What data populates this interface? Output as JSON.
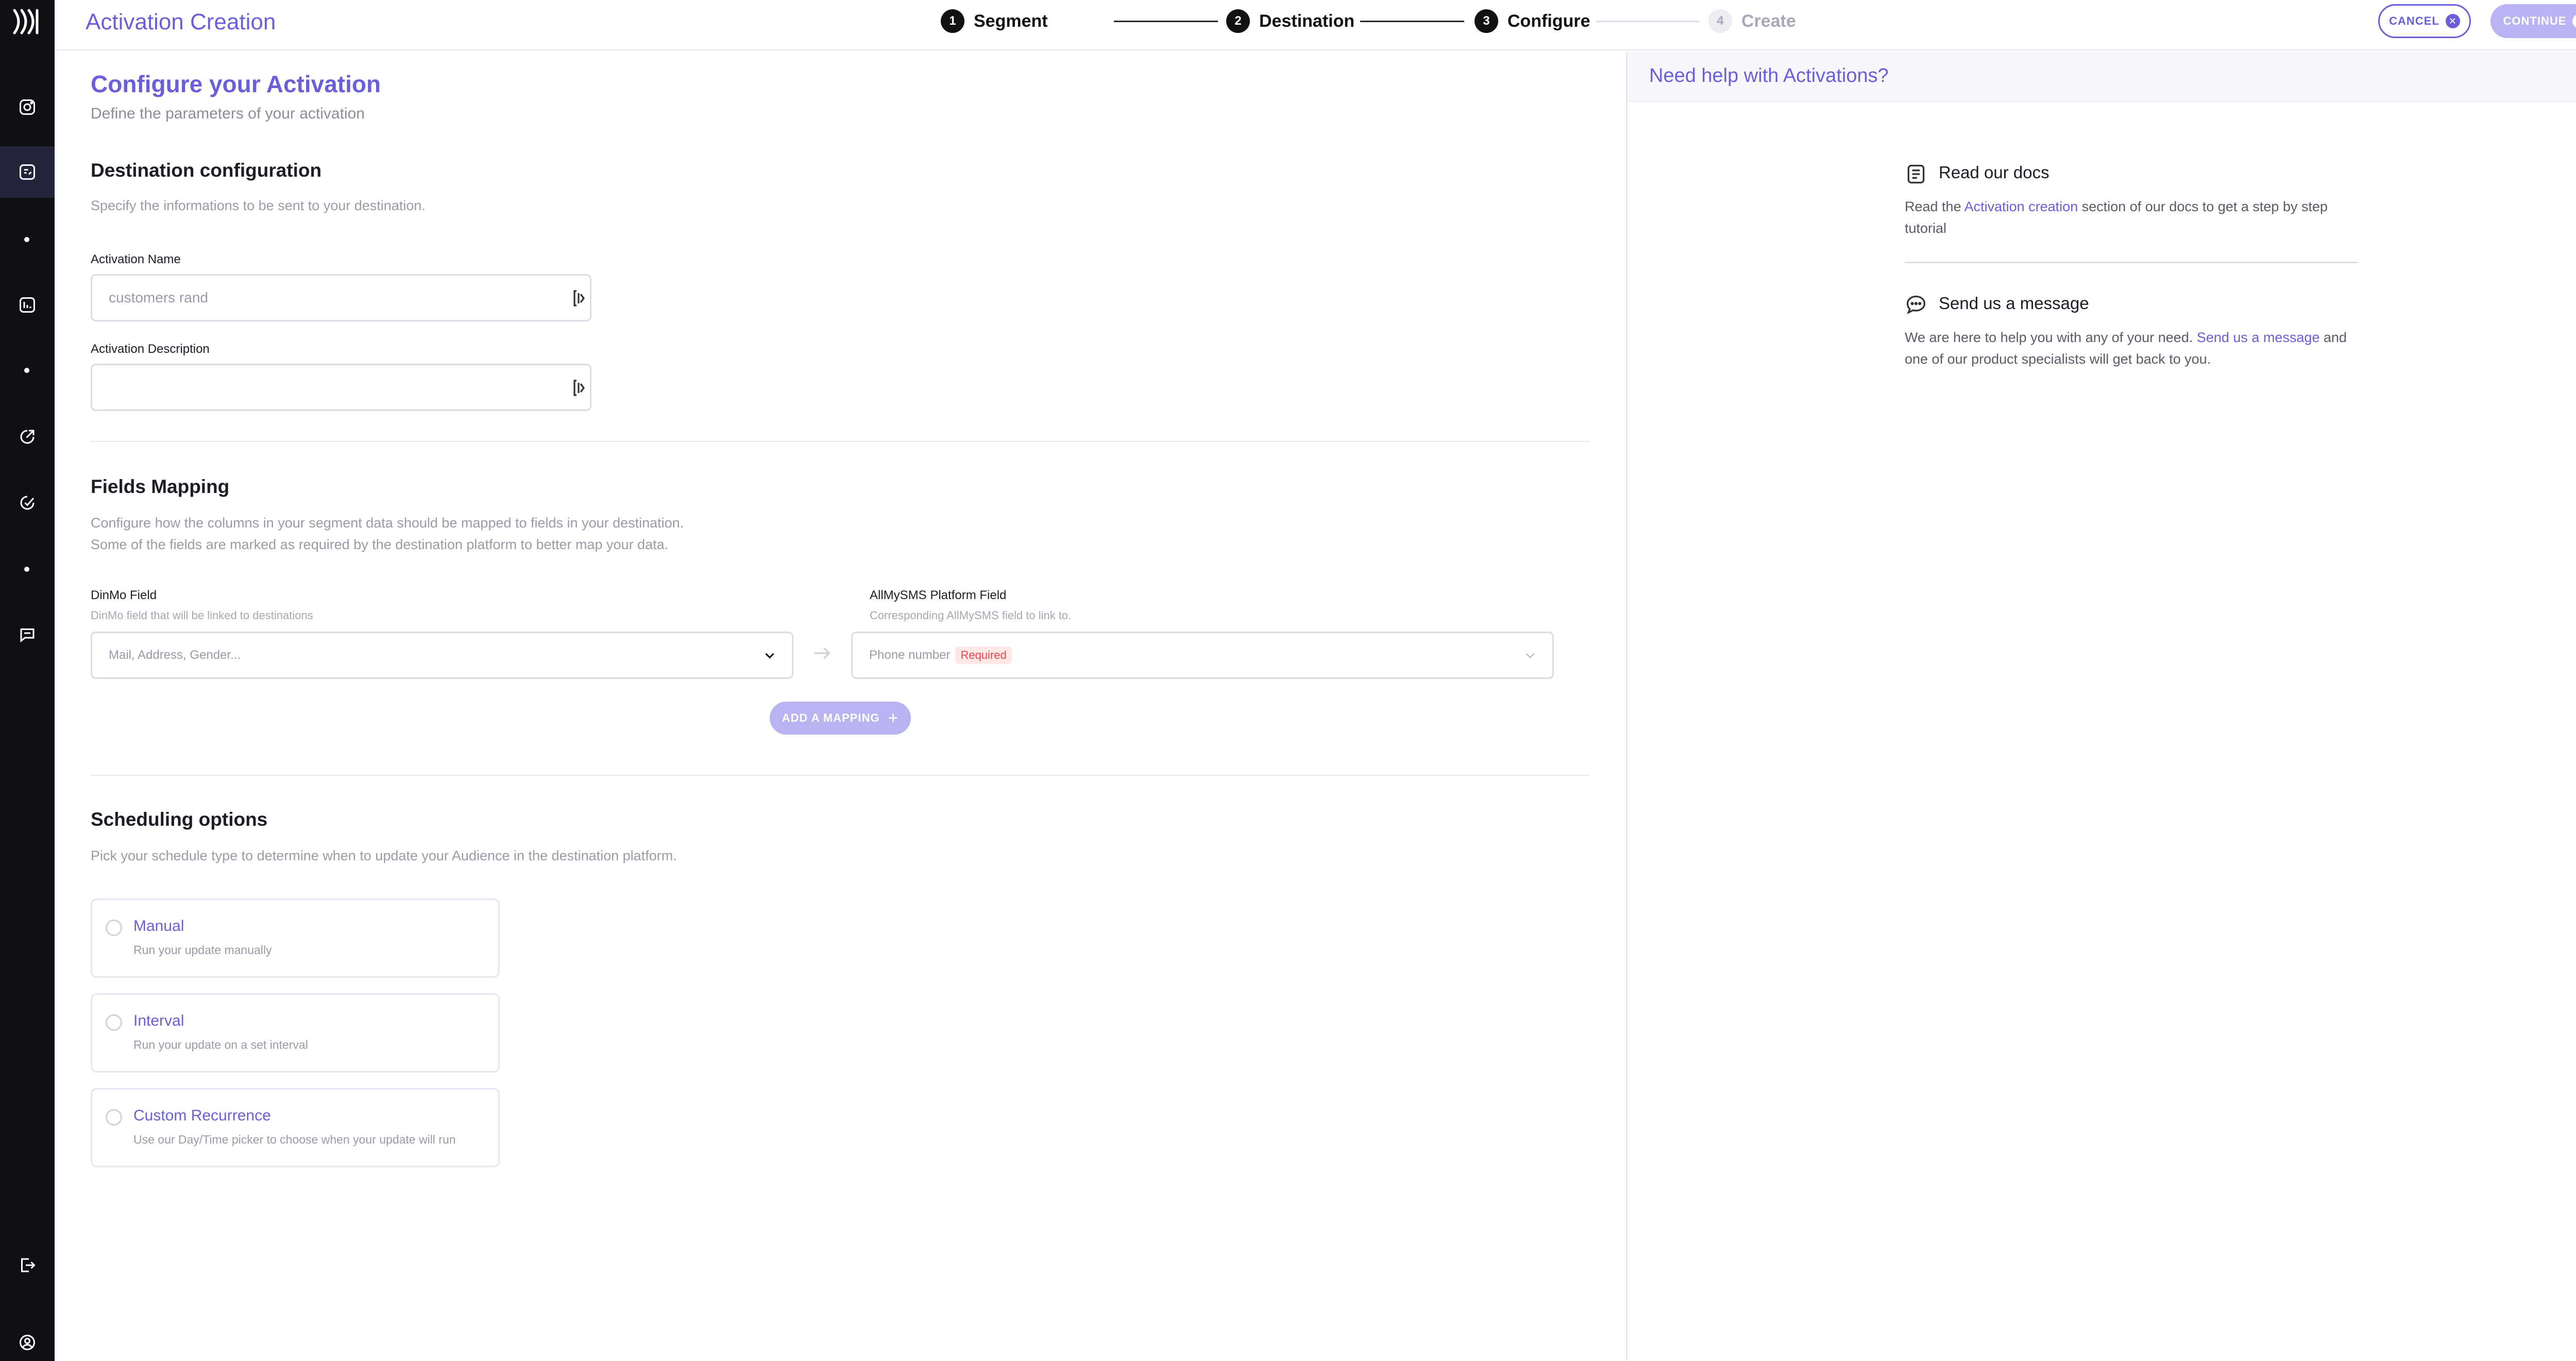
{
  "header": {
    "title": "Activation Creation",
    "steps": [
      {
        "num": "1",
        "label": "Segment"
      },
      {
        "num": "2",
        "label": "Destination"
      },
      {
        "num": "3",
        "label": "Configure"
      },
      {
        "num": "4",
        "label": "Create"
      }
    ],
    "cancel_label": "CANCEL",
    "continue_label": "CONTINUE"
  },
  "main": {
    "title": "Configure your Activation",
    "subtitle": "Define the parameters of your activation",
    "destination": {
      "title": "Destination configuration",
      "desc": "Specify the informations to be sent to your destination.",
      "name_label": "Activation Name",
      "name_value": "customers rand",
      "desc_label": "Activation Description",
      "desc_value": ""
    },
    "mapping": {
      "title": "Fields Mapping",
      "desc_line1": "Configure how the columns in your segment data should be mapped to fields in your destination.",
      "desc_line2": "Some of the fields are marked as required by the destination platform to better map your data.",
      "source_label": "DinMo Field",
      "source_hint": "DinMo field that will be linked to destinations",
      "source_placeholder": "Mail, Address, Gender...",
      "target_label": "AllMySMS Platform Field",
      "target_hint": "Corresponding AllMySMS field to link to.",
      "target_value": "Phone number",
      "required_badge": "Required",
      "add_label": "ADD A MAPPING"
    },
    "scheduling": {
      "title": "Scheduling options",
      "desc": "Pick your schedule type to determine when to update your Audience in the destination platform.",
      "options": [
        {
          "title": "Manual",
          "desc": "Run your update manually"
        },
        {
          "title": "Interval",
          "desc": "Run your update on a set interval"
        },
        {
          "title": "Custom Recurrence",
          "desc": "Use our Day/Time picker to choose when your update will run"
        }
      ]
    }
  },
  "help": {
    "title": "Need help with Activations?",
    "docs": {
      "heading": "Read our docs",
      "pre": "Read the ",
      "link": "Activation creation",
      "post": " section of our docs to get a step by step tutorial"
    },
    "message": {
      "heading": "Send us a message",
      "pre": "We are here to help you with any of your need. ",
      "link": "Send us a message",
      "post": " and one of our product specialists will get back to you."
    }
  },
  "colors": {
    "accent": "#6a5fd9",
    "accent_light": "#b9b3f2",
    "rail": "#0f0f14",
    "required": "#e5484d"
  }
}
